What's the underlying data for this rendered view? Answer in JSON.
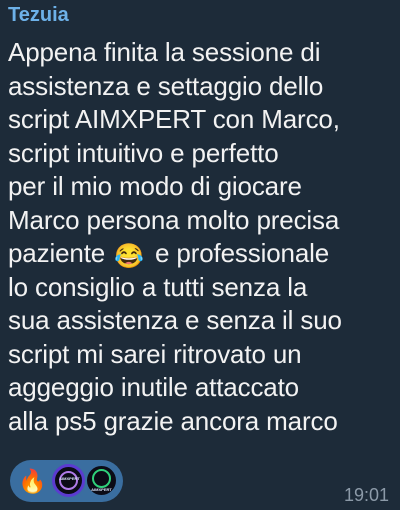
{
  "message": {
    "sender": "Tezuia",
    "lines": [
      "Appena finita la sessione di",
      "assistenza e settaggio dello",
      "script AIMXPERT con Marco,",
      "script intuitivo e perfetto",
      "per il mio modo di giocare",
      "Marco persona molto precisa",
      "paziente",
      "e professionale",
      "lo consiglio a tutti senza la",
      "sua assistenza e senza il suo",
      "script mi sarei ritrovato un",
      "aggeggio inutile attaccato",
      "alla ps5 grazie ancora marco"
    ],
    "inline_emoji": "😂",
    "time": "19:01"
  },
  "reactions": {
    "emoji": "🔥",
    "avatar_1_text": "AIMXPERT",
    "avatar_2_text": "AIMXPERT"
  },
  "colors": {
    "bubble_bg": "#1d2b39",
    "sender": "#6db1e8",
    "text": "#f2f2f2",
    "reaction_pill": "#3a6ea0",
    "time": "#8c9aa8"
  },
  "icons": {
    "fire": "fire-icon",
    "laugh": "tears-of-joy-emoji"
  }
}
